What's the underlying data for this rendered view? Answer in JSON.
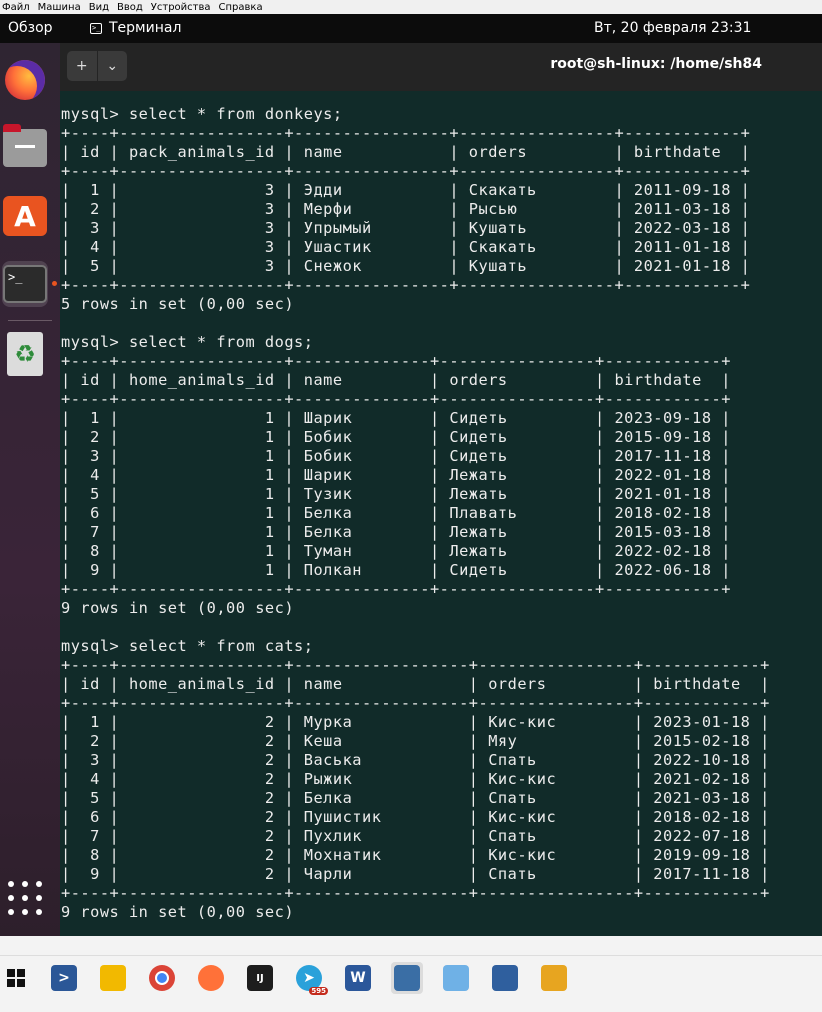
{
  "vbox_menu": [
    "Файл",
    "Машина",
    "Вид",
    "Ввод",
    "Устройства",
    "Справка"
  ],
  "topbar": {
    "overview": "Обзор",
    "app_name": "Терминал",
    "clock": "Вт, 20 февраля  23:31"
  },
  "dock": {
    "apps": [
      "firefox-icon",
      "files-icon",
      "software-icon",
      "terminal-icon",
      "trash-icon",
      "app-grid-icon"
    ],
    "terminal_glyph": ">_"
  },
  "terminal": {
    "title": "root@sh-linux: /home/sh84",
    "new_tab_glyph": "+",
    "menu_glyph": "⌄",
    "lines": [
      "mysql> select * from donkeys;",
      "+----+-----------------+----------------+----------------+------------+",
      "| id | pack_animals_id | name           | orders         | birthdate  |",
      "+----+-----------------+----------------+----------------+------------+",
      "|  1 |               3 | Эдди           | Скакать        | 2011-09-18 |",
      "|  2 |               3 | Мерфи          | Рысью          | 2011-03-18 |",
      "|  3 |               3 | Упрымый        | Кушать         | 2022-03-18 |",
      "|  4 |               3 | Ушастик        | Скакать        | 2011-01-18 |",
      "|  5 |               3 | Снежок         | Кушать         | 2021-01-18 |",
      "+----+-----------------+----------------+----------------+------------+",
      "5 rows in set (0,00 sec)",
      "",
      "mysql> select * from dogs;",
      "+----+-----------------+--------------+----------------+------------+",
      "| id | home_animals_id | name         | orders         | birthdate  |",
      "+----+-----------------+--------------+----------------+------------+",
      "|  1 |               1 | Шарик        | Сидеть         | 2023-09-18 |",
      "|  2 |               1 | Бобик        | Сидеть         | 2015-09-18 |",
      "|  3 |               1 | Бобик        | Сидеть         | 2017-11-18 |",
      "|  4 |               1 | Шарик        | Лежать         | 2022-01-18 |",
      "|  5 |               1 | Тузик        | Лежать         | 2021-01-18 |",
      "|  6 |               1 | Белка        | Плавать        | 2018-02-18 |",
      "|  7 |               1 | Белка        | Лежать         | 2015-03-18 |",
      "|  8 |               1 | Туман        | Лежать         | 2022-02-18 |",
      "|  9 |               1 | Полкан       | Сидеть         | 2022-06-18 |",
      "+----+-----------------+--------------+----------------+------------+",
      "9 rows in set (0,00 sec)",
      "",
      "mysql> select * from cats;",
      "+----+-----------------+------------------+----------------+------------+",
      "| id | home_animals_id | name             | orders         | birthdate  |",
      "+----+-----------------+------------------+----------------+------------+",
      "|  1 |               2 | Мурка            | Кис-кис        | 2023-01-18 |",
      "|  2 |               2 | Кеша             | Мяу            | 2015-02-18 |",
      "|  3 |               2 | Васька           | Спать          | 2022-10-18 |",
      "|  4 |               2 | Рыжик            | Кис-кис        | 2021-02-18 |",
      "|  5 |               2 | Белка            | Спать          | 2021-03-18 |",
      "|  6 |               2 | Пушистик         | Кис-кис        | 2018-02-18 |",
      "|  7 |               2 | Пухлик           | Спать          | 2022-07-18 |",
      "|  8 |               2 | Мохнатик         | Кис-кис        | 2019-09-18 |",
      "|  9 |               2 | Чарли            | Спать          | 2017-11-18 |",
      "+----+-----------------+------------------+----------------+------------+",
      "9 rows in set (0,00 sec)"
    ]
  },
  "taskbar": {
    "items": [
      {
        "name": "windows-start-icon",
        "color": "#111111"
      },
      {
        "name": "powershell-icon",
        "color": "#2b5797"
      },
      {
        "name": "file-explorer-icon",
        "color": "#f2b900"
      },
      {
        "name": "chrome-icon",
        "color": "#db4437"
      },
      {
        "name": "firefox-taskbar-icon",
        "color": "#ff7139"
      },
      {
        "name": "jetbrains-icon",
        "color": "#1d1d1d"
      },
      {
        "name": "telegram-icon",
        "color": "#2aa1da"
      },
      {
        "name": "word-icon",
        "color": "#2b579a"
      },
      {
        "name": "mysql-workbench-icon",
        "color": "#3a6ea5"
      },
      {
        "name": "paint-icon",
        "color": "#6fb1e6"
      },
      {
        "name": "virtualbox-icon",
        "color": "#2f5f9e"
      },
      {
        "name": "sticky-notes-icon",
        "color": "#e7a520"
      }
    ],
    "telegram_badge": "595",
    "word_letter": "W",
    "jetbrains_letter": "IJ",
    "powershell_glyph": ">"
  }
}
